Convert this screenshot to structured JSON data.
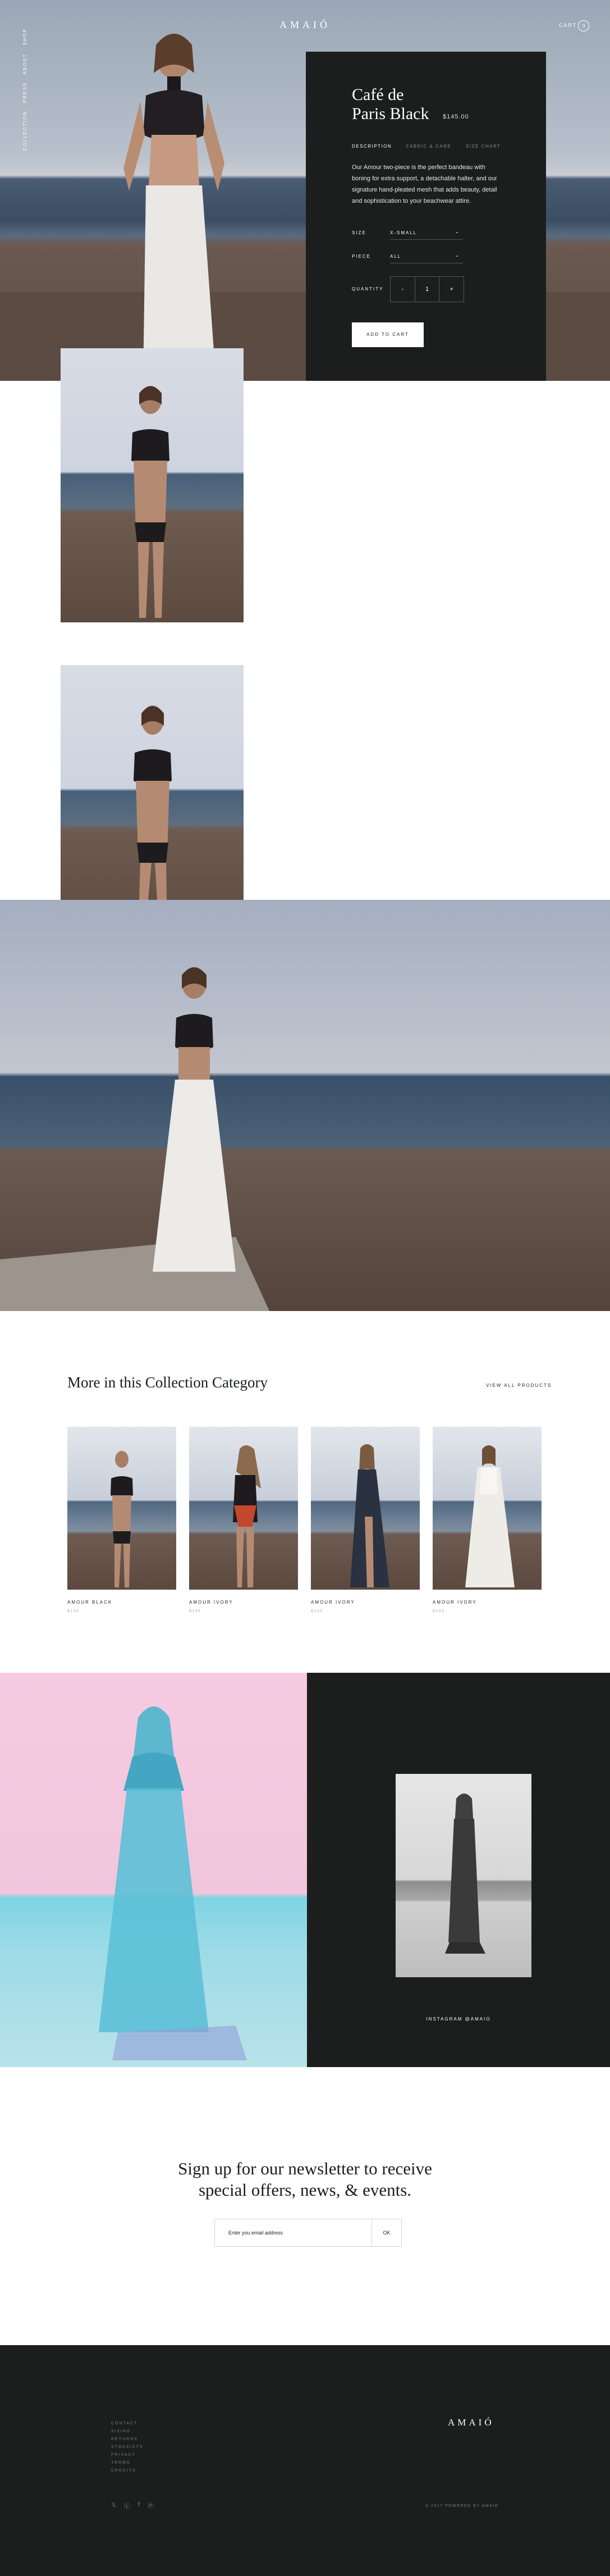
{
  "brand": "AMAIÓ",
  "nav": {
    "vertical_items": [
      "SHOP",
      "ABOUT",
      "PRESS",
      "COLLECTION"
    ],
    "cart_label": "CART",
    "cart_count": "0"
  },
  "product": {
    "title_line1": "Café de",
    "title_line2": "Paris Black",
    "price": "$145.00",
    "tabs": [
      "DESCRIPTION",
      "FABRIC & CARE",
      "SIZE CHART"
    ],
    "description": "Our Amour two-piece is the perfect bandeau with boning for extra support, a detachable halter, and our signature hand-pleated mesh that adds beauty, detail and sophistication to your beachwear attire.",
    "size_label": "SIZE",
    "size_value": "X-SMALL",
    "piece_label": "PIECE",
    "piece_value": "ALL",
    "quantity_label": "QUANTITY",
    "qty_minus": "-",
    "qty_value": "1",
    "qty_plus": "+",
    "chevron": "⌄",
    "add_to_cart": "ADD TO CART"
  },
  "more": {
    "title": "More in this Collection Category",
    "view_all": "VIEW ALL PRODUCTS",
    "cards": [
      {
        "name": "AMOUR BLACK",
        "sub": "$145"
      },
      {
        "name": "AMOUR IVORY",
        "sub": "$145"
      },
      {
        "name": "AMOUR IVORY",
        "sub": "$145"
      },
      {
        "name": "AMOUR IVORY",
        "sub": "$145"
      }
    ]
  },
  "instagram": {
    "label": "INSTAGRAM @AMAIO"
  },
  "newsletter": {
    "title_line1": "Sign up for our newsletter to receive",
    "title_line2": "special offers, news, & events.",
    "placeholder": "Enter you email address",
    "ok": "OK"
  },
  "footer": {
    "brand": "AMAIÓ",
    "links": [
      "CONTACT",
      "SIZING",
      "RETURNS",
      "STOCKISTS",
      "PRIVACY",
      "TERMS",
      "CREDITS"
    ],
    "social_icons": [
      "twitter-icon",
      "linkedin-icon",
      "facebook-icon",
      "pinterest-icon"
    ],
    "copyright": "© 2017 POWERED BY AMAIO"
  }
}
